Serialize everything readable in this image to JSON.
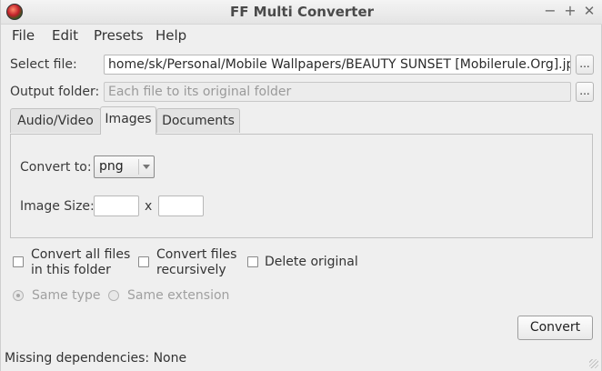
{
  "window": {
    "title": "FF Multi Converter"
  },
  "window_controls": {
    "minimize": "−",
    "maximize": "+",
    "close": "✕"
  },
  "menu": {
    "items": [
      "File",
      "Edit",
      "Presets",
      "Help"
    ]
  },
  "select_file": {
    "label": "Select file:",
    "value": "home/sk/Personal/Mobile Wallpapers/BEAUTY SUNSET [Mobilerule.Org].jpg",
    "browse_label": "..."
  },
  "output_folder": {
    "label": "Output folder:",
    "placeholder": "Each file to its original folder",
    "browse_label": "..."
  },
  "tabs": [
    {
      "label": "Audio/Video",
      "active": false
    },
    {
      "label": "Images",
      "active": true
    },
    {
      "label": "Documents",
      "active": false
    }
  ],
  "images_panel": {
    "convert_to_label": "Convert to:",
    "convert_to_value": "png",
    "image_size_label": "Image Size:",
    "size_separator": "x",
    "width": "",
    "height": ""
  },
  "options": {
    "convert_all": {
      "line1": "Convert all files",
      "line2": "in this folder",
      "checked": false
    },
    "recursive": {
      "line1": "Convert files",
      "line2": "recursively",
      "checked": false
    },
    "delete_original": {
      "label": "Delete original",
      "checked": false
    }
  },
  "radios": {
    "same_type": {
      "label": "Same type",
      "checked": true,
      "enabled": false
    },
    "same_extension": {
      "label": "Same extension",
      "checked": false,
      "enabled": false
    }
  },
  "convert_button": {
    "label": "Convert"
  },
  "status": {
    "text": "Missing dependencies: None"
  }
}
